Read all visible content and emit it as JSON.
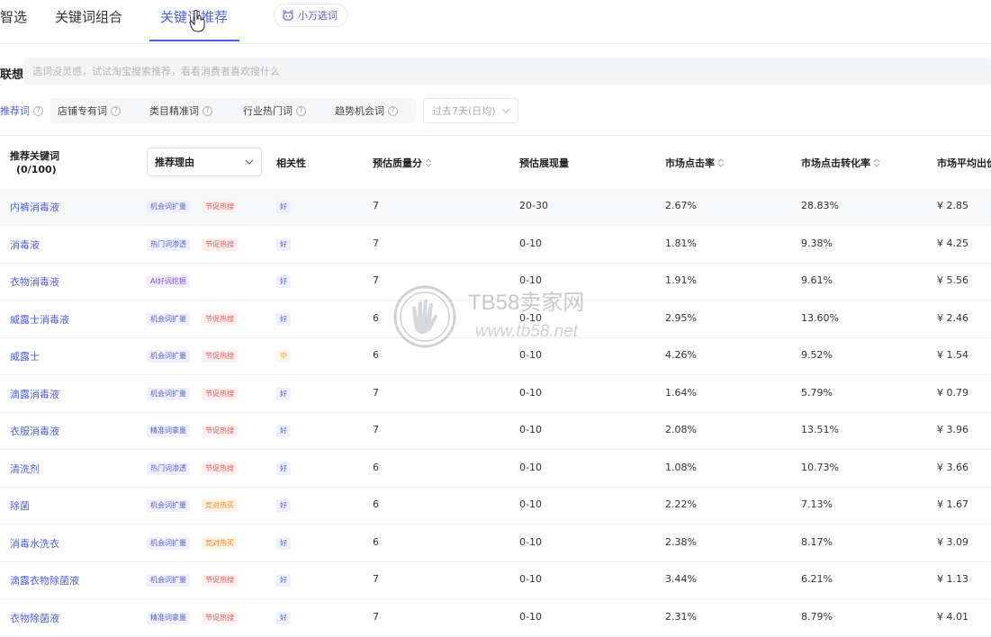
{
  "tabs": [
    {
      "label": "智选",
      "active": false
    },
    {
      "label": "关键词组合",
      "active": false
    },
    {
      "label": "关键词推荐",
      "active": true
    }
  ],
  "xiaowan": {
    "label": "小万选词",
    "icon": "bot-icon"
  },
  "search": {
    "label": "联想",
    "placeholder": "选词没灵感，试试淘宝搜索推荐，看看消费者喜欢搜什么"
  },
  "filters": {
    "chips": [
      {
        "label": "推荐词",
        "active": true
      },
      {
        "label": "店铺专有词",
        "active": false
      },
      {
        "label": "类目精准词",
        "active": false
      },
      {
        "label": "行业热门词",
        "active": false
      },
      {
        "label": "趋势机会词",
        "active": false
      }
    ],
    "help_icon": "?",
    "date_range": "过去7天(日均)"
  },
  "table": {
    "headers": {
      "keyword": "推荐关键词",
      "count": "(0/100)",
      "reason": "推荐理由",
      "relevance": "相关性",
      "quality": "预估质量分",
      "impressions": "预估展现量",
      "ctr": "市场点击率",
      "cvr": "市场点击转化率",
      "avg_bid": "市场平均出价"
    },
    "rows": [
      {
        "keyword": "内裤消毒液",
        "tags": [
          {
            "text": "机会词扩量",
            "color": "blue"
          },
          {
            "text": "节促热搜",
            "color": "red"
          }
        ],
        "relevance": "好",
        "rel_level": "good",
        "quality": "7",
        "impressions": "20-30",
        "ctr": "2.67%",
        "cvr": "28.83%",
        "bid": "¥ 2.85"
      },
      {
        "keyword": "消毒液",
        "tags": [
          {
            "text": "热门词渗透",
            "color": "blue"
          },
          {
            "text": "节促热搜",
            "color": "red"
          }
        ],
        "relevance": "好",
        "rel_level": "good",
        "quality": "7",
        "impressions": "0-10",
        "ctr": "1.81%",
        "cvr": "9.38%",
        "bid": "¥ 4.25"
      },
      {
        "keyword": "衣物消毒液",
        "tags": [
          {
            "text": "AI好词挖掘",
            "color": "purple"
          }
        ],
        "relevance": "好",
        "rel_level": "good",
        "quality": "7",
        "impressions": "0-10",
        "ctr": "1.91%",
        "cvr": "9.61%",
        "bid": "¥ 5.56"
      },
      {
        "keyword": "威露士消毒液",
        "tags": [
          {
            "text": "机会词扩量",
            "color": "blue"
          },
          {
            "text": "节促热搜",
            "color": "red"
          }
        ],
        "relevance": "好",
        "rel_level": "good",
        "quality": "6",
        "impressions": "0-10",
        "ctr": "2.95%",
        "cvr": "13.60%",
        "bid": "¥ 2.46"
      },
      {
        "keyword": "威露士",
        "tags": [
          {
            "text": "机会词扩量",
            "color": "blue"
          },
          {
            "text": "节促热搜",
            "color": "red"
          }
        ],
        "relevance": "中",
        "rel_level": "mid",
        "quality": "6",
        "impressions": "0-10",
        "ctr": "4.26%",
        "cvr": "9.52%",
        "bid": "¥ 1.54"
      },
      {
        "keyword": "滴露消毒液",
        "tags": [
          {
            "text": "机会词扩量",
            "color": "blue"
          },
          {
            "text": "节促热搜",
            "color": "red"
          }
        ],
        "relevance": "好",
        "rel_level": "good",
        "quality": "7",
        "impressions": "0-10",
        "ctr": "1.64%",
        "cvr": "5.79%",
        "bid": "¥ 0.79"
      },
      {
        "keyword": "衣服消毒液",
        "tags": [
          {
            "text": "精准词拿量",
            "color": "blue"
          },
          {
            "text": "节促热搜",
            "color": "red"
          }
        ],
        "relevance": "好",
        "rel_level": "good",
        "quality": "7",
        "impressions": "0-10",
        "ctr": "2.08%",
        "cvr": "13.51%",
        "bid": "¥ 3.96"
      },
      {
        "keyword": "清洗剂",
        "tags": [
          {
            "text": "热门词渗透",
            "color": "blue"
          },
          {
            "text": "节促热搜",
            "color": "red"
          }
        ],
        "relevance": "好",
        "rel_level": "good",
        "quality": "6",
        "impressions": "0-10",
        "ctr": "1.08%",
        "cvr": "10.73%",
        "bid": "¥ 3.66"
      },
      {
        "keyword": "除菌",
        "tags": [
          {
            "text": "机会词扩量",
            "color": "blue"
          },
          {
            "text": "竞对热买",
            "color": "orange"
          }
        ],
        "relevance": "好",
        "rel_level": "good",
        "quality": "6",
        "impressions": "0-10",
        "ctr": "2.22%",
        "cvr": "7.13%",
        "bid": "¥ 1.67"
      },
      {
        "keyword": "消毒水洗衣",
        "tags": [
          {
            "text": "机会词扩量",
            "color": "blue"
          },
          {
            "text": "竞对热买",
            "color": "orange"
          }
        ],
        "relevance": "好",
        "rel_level": "good",
        "quality": "6",
        "impressions": "0-10",
        "ctr": "2.38%",
        "cvr": "8.17%",
        "bid": "¥ 3.09"
      },
      {
        "keyword": "滴露衣物除菌液",
        "tags": [
          {
            "text": "机会词扩量",
            "color": "blue"
          },
          {
            "text": "节促热搜",
            "color": "red"
          }
        ],
        "relevance": "好",
        "rel_level": "good",
        "quality": "7",
        "impressions": "0-10",
        "ctr": "3.44%",
        "cvr": "6.21%",
        "bid": "¥ 1.13"
      },
      {
        "keyword": "衣物除菌液",
        "tags": [
          {
            "text": "精准词拿量",
            "color": "blue"
          },
          {
            "text": "节促热搜",
            "color": "red"
          }
        ],
        "relevance": "好",
        "rel_level": "good",
        "quality": "7",
        "impressions": "0-10",
        "ctr": "2.31%",
        "cvr": "8.79%",
        "bid": "¥ 4.01"
      }
    ]
  },
  "watermark": {
    "title": "TB58卖家网",
    "url": "www.tb58.net",
    "icon": "hand-logo-icon"
  },
  "colors": {
    "accent": "#4e5ee4",
    "tag_red": "#ee5a5a",
    "tag_orange": "#f08a2a",
    "tag_purple": "#7b55d8"
  }
}
